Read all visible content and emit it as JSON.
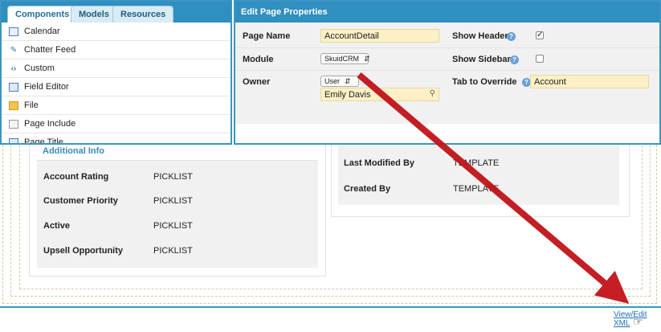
{
  "components_panel": {
    "tabs": [
      "Components",
      "Models",
      "Resources"
    ],
    "items": [
      {
        "label": "Calendar",
        "icon": "calendar-icon"
      },
      {
        "label": "Chatter Feed",
        "icon": "chatter-icon"
      },
      {
        "label": "Custom",
        "icon": "code-icon"
      },
      {
        "label": "Field Editor",
        "icon": "field-editor-icon"
      },
      {
        "label": "File",
        "icon": "file-icon"
      },
      {
        "label": "Page Include",
        "icon": "page-include-icon"
      },
      {
        "label": "Page Title",
        "icon": "page-title-icon"
      }
    ]
  },
  "properties_panel": {
    "title": "Edit Page Properties",
    "page_name_label": "Page Name",
    "page_name_value": "AccountDetail",
    "module_label": "Module",
    "module_value": "SkuidCRM",
    "owner_label": "Owner",
    "owner_type": "User",
    "owner_value": "Emily Davis",
    "show_header_label": "Show Header",
    "show_header_checked": true,
    "show_sidebar_label": "Show Sidebar",
    "show_sidebar_checked": false,
    "tab_override_label": "Tab to Override",
    "tab_override_value": "Account"
  },
  "canvas": {
    "additional_info_title": "Additional Info",
    "fields": [
      {
        "label": "Account Rating",
        "value": "PICKLIST"
      },
      {
        "label": "Customer Priority",
        "value": "PICKLIST"
      },
      {
        "label": "Active",
        "value": "PICKLIST"
      },
      {
        "label": "Upsell Opportunity",
        "value": "PICKLIST"
      }
    ],
    "modified": [
      {
        "label": "Last Modified By",
        "value": "TEMPLATE"
      },
      {
        "label": "Created By",
        "value": "TEMPLATE"
      }
    ]
  },
  "footer": {
    "view_edit_xml": "View/Edit XML"
  },
  "colors": {
    "header_blue": "#2f8fbe",
    "field_yellow": "#fbf0c6",
    "annotation_arrow": "#c0141a"
  }
}
